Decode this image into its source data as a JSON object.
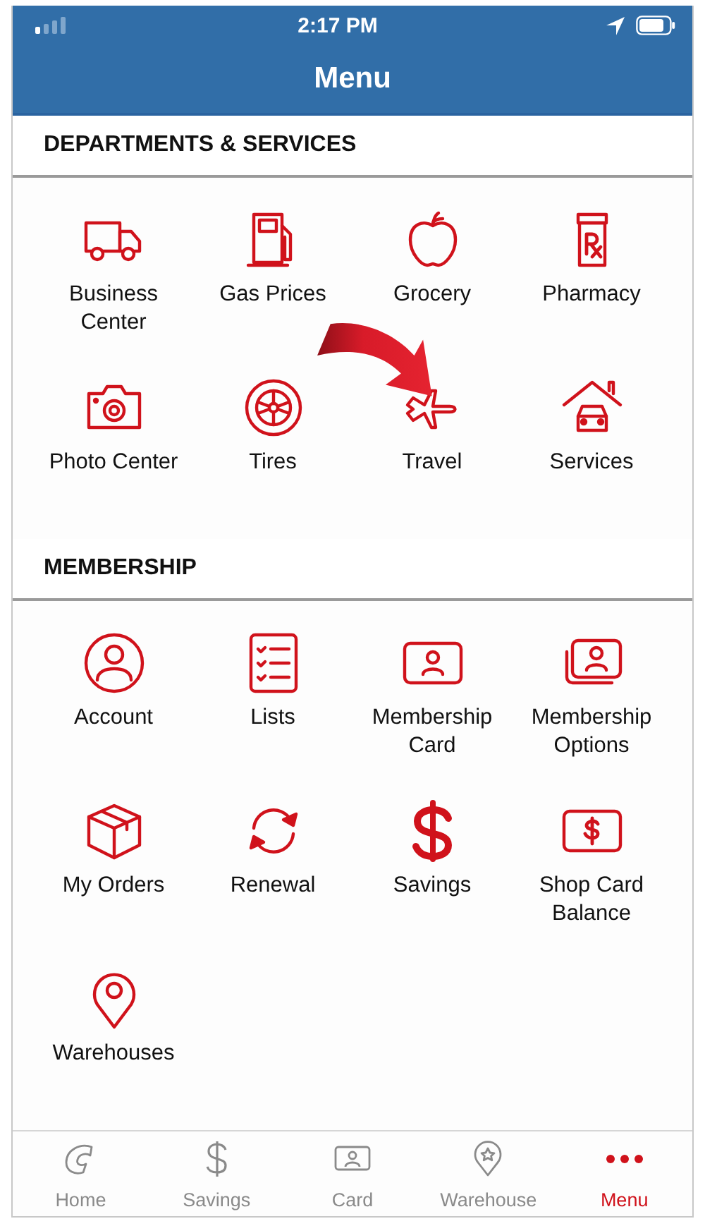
{
  "status_bar": {
    "time": "2:17 PM"
  },
  "header": {
    "title": "Menu"
  },
  "sections": [
    {
      "title": "DEPARTMENTS & SERVICES",
      "items": [
        {
          "label": "Business Center"
        },
        {
          "label": "Gas Prices"
        },
        {
          "label": "Grocery"
        },
        {
          "label": "Pharmacy"
        },
        {
          "label": "Photo Center"
        },
        {
          "label": "Tires"
        },
        {
          "label": "Travel"
        },
        {
          "label": "Services"
        }
      ]
    },
    {
      "title": "MEMBERSHIP",
      "items": [
        {
          "label": "Account"
        },
        {
          "label": "Lists"
        },
        {
          "label": "Membership Card"
        },
        {
          "label": "Membership Options"
        },
        {
          "label": "My Orders"
        },
        {
          "label": "Renewal"
        },
        {
          "label": "Savings"
        },
        {
          "label": "Shop Card Balance"
        },
        {
          "label": "Warehouses"
        }
      ]
    }
  ],
  "tab_bar": [
    {
      "label": "Home",
      "selected": false
    },
    {
      "label": "Savings",
      "selected": false
    },
    {
      "label": "Card",
      "selected": false
    },
    {
      "label": "Warehouse",
      "selected": false
    },
    {
      "label": "Menu",
      "selected": true
    }
  ]
}
